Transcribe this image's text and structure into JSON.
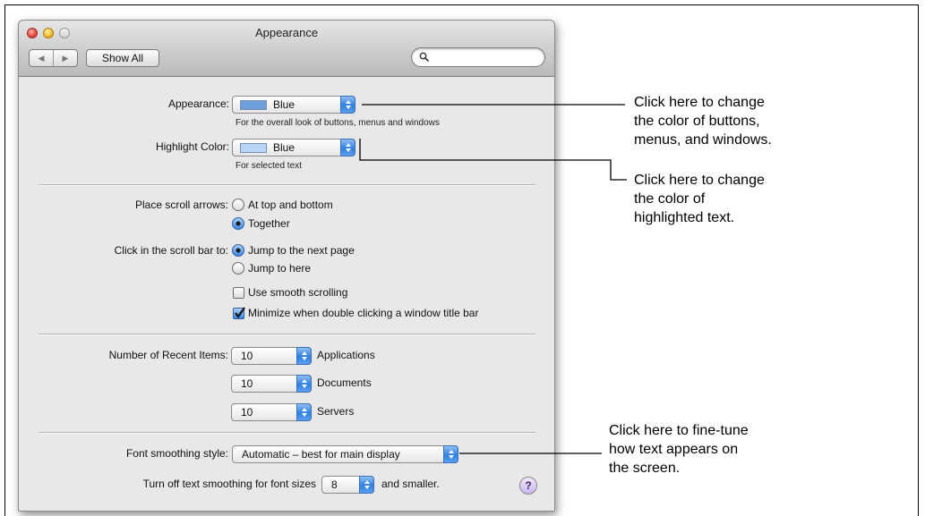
{
  "window": {
    "title": "Appearance",
    "nav_back": "◀",
    "nav_forward": "▶",
    "show_all_label": "Show All",
    "search_placeholder": ""
  },
  "appearance": {
    "label": "Appearance:",
    "value": "Blue",
    "swatch_color": "#6f9fdc",
    "hint": "For the overall look of buttons, menus and windows"
  },
  "highlight": {
    "label": "Highlight Color:",
    "value": "Blue",
    "swatch_color": "#b9d5f7",
    "hint": "For selected text"
  },
  "scroll_arrows": {
    "label": "Place scroll arrows:",
    "options": [
      "At top and bottom",
      "Together"
    ],
    "selected": "Together"
  },
  "scroll_click": {
    "label": "Click in the scroll bar to:",
    "options": [
      "Jump to the next page",
      "Jump to here"
    ],
    "selected": "Jump to the next page"
  },
  "checkboxes": [
    {
      "label": "Use smooth scrolling",
      "checked": false
    },
    {
      "label": "Minimize when double clicking a window title bar",
      "checked": true
    }
  ],
  "recent_items": {
    "label": "Number of Recent Items:",
    "rows": [
      {
        "value": "10",
        "suffix": "Applications"
      },
      {
        "value": "10",
        "suffix": "Documents"
      },
      {
        "value": "10",
        "suffix": "Servers"
      }
    ]
  },
  "font_smoothing": {
    "label": "Font smoothing style:",
    "value": "Automatic – best for main display"
  },
  "text_smoothing": {
    "label": "Turn off text smoothing for font sizes",
    "value": "8",
    "suffix": "and smaller."
  },
  "help_label": "?",
  "callouts": [
    [
      "Click here to change",
      "the color of buttons,",
      "menus, and windows."
    ],
    [
      "Click here to change",
      "the color of",
      "highlighted text."
    ],
    [
      "Click here to fine-tune",
      "how text appears on",
      "the screen."
    ]
  ],
  "accent_color": "#3b87e6"
}
